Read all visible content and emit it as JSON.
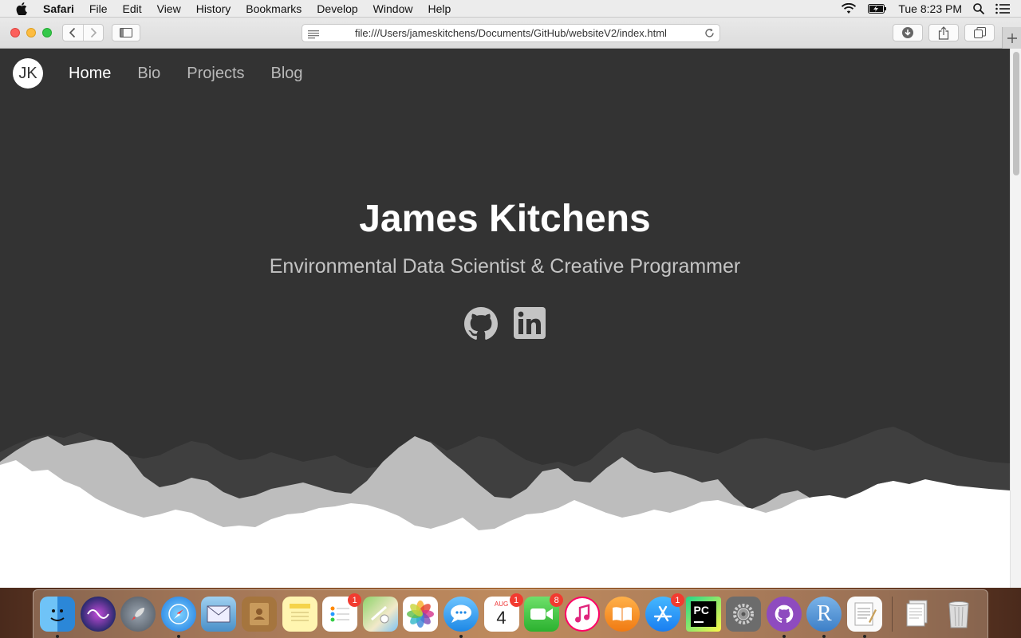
{
  "menubar": {
    "app_name": "Safari",
    "items": [
      "File",
      "Edit",
      "View",
      "History",
      "Bookmarks",
      "Develop",
      "Window",
      "Help"
    ],
    "clock": "Tue 8:23 PM"
  },
  "browser": {
    "url": "file:///Users/jameskitchens/Documents/GitHub/websiteV2/index.html"
  },
  "site": {
    "logo": "JK",
    "nav": [
      {
        "label": "Home",
        "active": true
      },
      {
        "label": "Bio",
        "active": false
      },
      {
        "label": "Projects",
        "active": false
      },
      {
        "label": "Blog",
        "active": false
      }
    ],
    "title": "James Kitchens",
    "subtitle": "Environmental Data Scientist & Creative Programmer",
    "social": [
      "github-icon",
      "linkedin-icon"
    ]
  },
  "dock": {
    "apps": [
      {
        "name": "finder",
        "running": true,
        "badge": ""
      },
      {
        "name": "siri",
        "running": false,
        "badge": ""
      },
      {
        "name": "launchpad",
        "running": false,
        "badge": ""
      },
      {
        "name": "safari",
        "running": true,
        "badge": ""
      },
      {
        "name": "mail",
        "running": false,
        "badge": ""
      },
      {
        "name": "contacts",
        "running": false,
        "badge": ""
      },
      {
        "name": "notes",
        "running": false,
        "badge": ""
      },
      {
        "name": "reminders",
        "running": false,
        "badge": "1"
      },
      {
        "name": "maps",
        "running": false,
        "badge": ""
      },
      {
        "name": "photos",
        "running": false,
        "badge": ""
      },
      {
        "name": "messages",
        "running": true,
        "badge": ""
      },
      {
        "name": "calendar",
        "running": false,
        "badge": "1"
      },
      {
        "name": "facetime",
        "running": false,
        "badge": "8"
      },
      {
        "name": "itunes",
        "running": false,
        "badge": ""
      },
      {
        "name": "ibooks",
        "running": false,
        "badge": ""
      },
      {
        "name": "app-store",
        "running": false,
        "badge": "1"
      },
      {
        "name": "pycharm",
        "running": false,
        "badge": ""
      },
      {
        "name": "system-preferences",
        "running": false,
        "badge": ""
      },
      {
        "name": "github-desktop",
        "running": true,
        "badge": ""
      },
      {
        "name": "r",
        "running": true,
        "badge": ""
      },
      {
        "name": "textedit",
        "running": true,
        "badge": ""
      }
    ],
    "calendar_month": "AUG",
    "calendar_day": "4",
    "pycharm_label": "PC",
    "r_label": "R"
  },
  "colors": {
    "page_bg": "#333333",
    "nav_active": "#ffffff",
    "nav_inactive": "#b9b9b9",
    "mountain_dark": "#3f3f3f",
    "mountain_light": "#bdbdbd",
    "mountain_front": "#ffffff"
  }
}
